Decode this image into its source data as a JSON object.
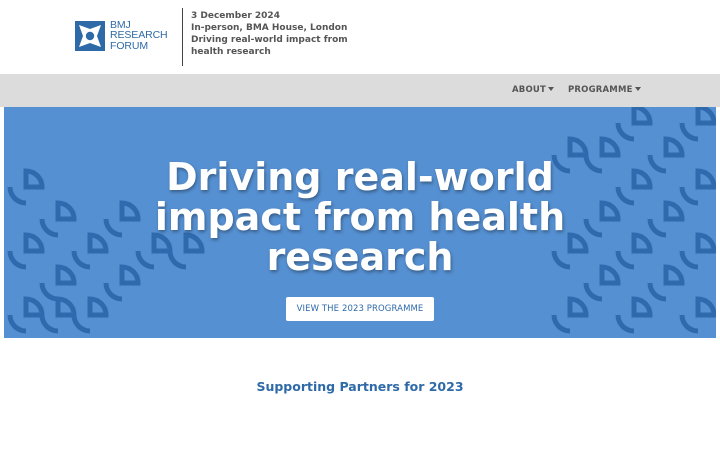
{
  "colors": {
    "brand_blue": "#2f6aa8",
    "hero_blue": "#5590d2",
    "pattern_blue": "#2a64a8",
    "nav_bg": "#dcdcdc"
  },
  "header": {
    "logo": {
      "icon": "bmj-forum-logo-mark",
      "lines": [
        "BMJ",
        "RESEARCH",
        "FORUM"
      ]
    },
    "event": {
      "date": "3 December 2024",
      "location": "In-person, BMA House, London",
      "tagline": "Driving real-world impact from health research"
    }
  },
  "nav": {
    "items": [
      {
        "label": "ABOUT",
        "icon": "caret-down-icon"
      },
      {
        "label": "PROGRAMME",
        "icon": "caret-down-icon"
      }
    ]
  },
  "hero": {
    "title_lines": [
      "Driving real-world",
      "impact from health",
      "research"
    ],
    "button_label": "VIEW THE 2023 PROGRAMME"
  },
  "partners": {
    "heading": "Supporting Partners for 2023"
  }
}
